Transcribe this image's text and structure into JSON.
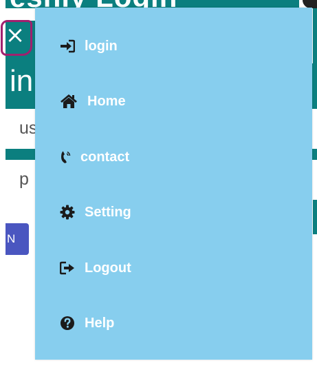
{
  "background": {
    "top_title": "eshly Login",
    "login_heading": "in",
    "username_peek": "us",
    "password_peek": "p",
    "submit_peek": "N"
  },
  "close_button": {
    "icon": "close-icon",
    "label": "×"
  },
  "menu": {
    "items": [
      {
        "label": "login",
        "icon": "sign-in-icon"
      },
      {
        "label": "Home",
        "icon": "home-icon"
      },
      {
        "label": "contact",
        "icon": "phone-volume-icon"
      },
      {
        "label": "Setting",
        "icon": "gear-icon"
      },
      {
        "label": "Logout",
        "icon": "sign-out-icon"
      },
      {
        "label": "Help",
        "icon": "question-circle-icon"
      }
    ]
  },
  "colors": {
    "menu_background": "#87ceee",
    "teal": "#0b7f7f",
    "highlight_ring": "#a0206e",
    "submit_button": "#4a56c0"
  }
}
